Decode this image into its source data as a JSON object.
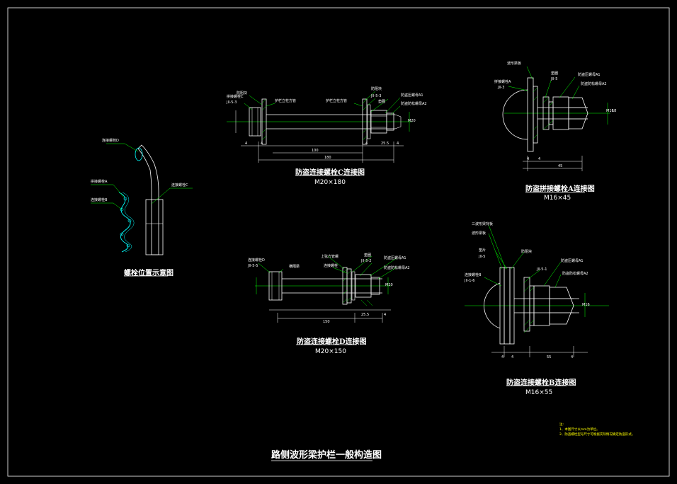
{
  "sheet_title": "路侧波形梁护栏一般构造图",
  "colors": {
    "background": "#000000",
    "outline": "#ffffff",
    "bolt": "#ffffff",
    "hatch": "#00ff00",
    "leader": "#00ff00",
    "centerline": "#00ff00",
    "guardrail": "#00ffff",
    "notes": "#ffff00"
  },
  "views": {
    "position": {
      "title": "螺栓位置示意图",
      "labels": {
        "a": "连接螺栓D",
        "b": "拼接螺栓A",
        "c": "连接螺栓B",
        "d": "连接螺栓C"
      }
    },
    "c": {
      "title": "防盗连接螺栓C连接图",
      "spec": "M20×180",
      "labels": {
        "a": "防阻块",
        "b": "拼接螺栓C",
        "c": "JII-5-3",
        "d": "护栏立柱方管",
        "e": "护栏立柱方管",
        "f": "防阻块",
        "g": "JII-5-3",
        "h": "垫圈",
        "i": "防盗压螺母A1",
        "j": "防盗防松螺母A2",
        "k": "M20"
      },
      "dims": {
        "a": "4",
        "b": "4",
        "c": "100",
        "d": "180",
        "e": "4",
        "f": "25.5",
        "g": "4"
      }
    },
    "a": {
      "title": "防盗拼接螺栓A连接图",
      "spec": "M16×45",
      "labels": {
        "a": "波形梁板",
        "b": "拼接螺栓A",
        "c": "JII-3",
        "d": "垫圈",
        "e": "JII-5",
        "f": "防盗压螺母A1",
        "g": "防盗防松螺母A2",
        "h": "M16"
      },
      "dims": {
        "a": "4",
        "b": "4",
        "c": "45",
        "d": "18"
      }
    },
    "d": {
      "title": "防盗连接螺栓D连接图",
      "spec": "M20×150",
      "labels": {
        "a": "连接螺栓D",
        "b": "JII-5-5",
        "c": "横隔梁",
        "d": "上弦方管螺",
        "e": "连接螺栓",
        "f": "垫圈",
        "g": "JII-5-2",
        "h": "防盗压螺母A1",
        "i": "防盗防松螺母A2",
        "j": "M20"
      },
      "dims": {
        "a": "150",
        "b": "25.5",
        "c": "4"
      }
    },
    "b": {
      "title": "防盗连接螺栓B连接图",
      "spec": "M16×55",
      "labels": {
        "a": "三波形梁背板",
        "b": "波形梁板",
        "c": "垫片",
        "d": "JII-5",
        "e": "防阻块",
        "f": "连接螺栓B",
        "g": "JII-1-6",
        "h": "防盗压螺母A1",
        "i": "JII-5-1",
        "j": "防盗防松螺母A2",
        "k": "M16"
      },
      "dims": {
        "a": "4",
        "b": "4",
        "c": "55",
        "d": "4"
      }
    }
  },
  "notes": [
    "注:",
    "1、本图尺寸以mm为单位。",
    "2、防盗螺栓型号尺寸可根据实际情况确定防盗形式。"
  ]
}
